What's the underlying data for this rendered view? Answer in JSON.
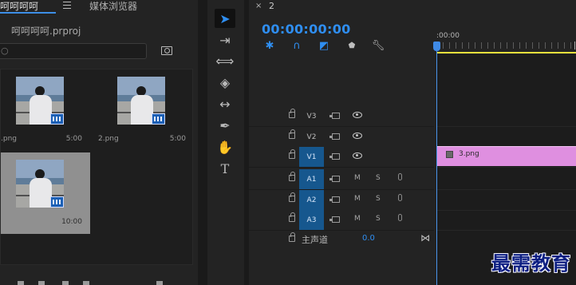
{
  "project_panel": {
    "tab_title": "呵呵呵呵",
    "media_browser_tab": "媒体浏览器",
    "project_file": "呵呵呵呵.prproj",
    "search_value": "",
    "clips": [
      {
        "name": ".png",
        "duration": "5:00",
        "selected": false
      },
      {
        "name": "2.png",
        "duration": "5:00",
        "selected": false
      },
      {
        "name": "",
        "duration": "10:00",
        "selected": true
      }
    ]
  },
  "tools": [
    {
      "icon": "selection-tool-icon",
      "active": true
    },
    {
      "icon": "track-select-tool-icon",
      "active": false
    },
    {
      "icon": "ripple-edit-tool-icon",
      "active": false
    },
    {
      "icon": "razor-tool-icon",
      "active": false
    },
    {
      "icon": "slip-tool-icon",
      "active": false
    },
    {
      "icon": "pen-tool-icon",
      "active": false
    },
    {
      "icon": "hand-tool-icon",
      "active": false
    },
    {
      "icon": "type-tool-icon",
      "active": false
    }
  ],
  "timeline": {
    "sequence_close": "×",
    "sequence_tab": "2",
    "timecode": "00:00:00:00",
    "ruler_label": ":00:00",
    "video_tracks": [
      {
        "name": "V3",
        "targeted": false
      },
      {
        "name": "V2",
        "targeted": false
      },
      {
        "name": "V1",
        "targeted": true
      }
    ],
    "audio_tracks": [
      {
        "name": "A1",
        "targeted": true,
        "mute": "M",
        "solo": "S"
      },
      {
        "name": "A2",
        "targeted": true,
        "mute": "M",
        "solo": "S"
      },
      {
        "name": "A3",
        "targeted": true,
        "mute": "M",
        "solo": "S"
      }
    ],
    "master": {
      "label": "主声道",
      "value": "0.0"
    },
    "clip_on_v1": {
      "name": "3.png",
      "color": "#df8fe0"
    }
  },
  "watermark": "最需教育",
  "colors": {
    "accent": "#2f8ef1",
    "track_target": "#16578e",
    "clip": "#df8fe0",
    "work_area": "#e8e03c"
  }
}
